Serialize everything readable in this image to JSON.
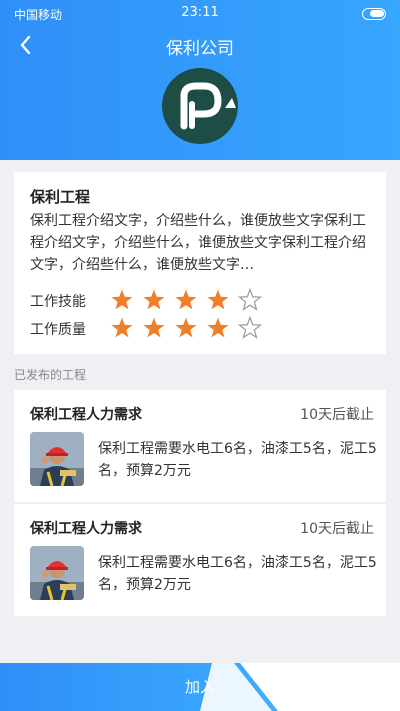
{
  "status_bar": {
    "carrier": "中国移动",
    "time": "23:11"
  },
  "nav": {
    "title": "保利公司",
    "back_icon": "chevron-left-icon"
  },
  "company": {
    "logo_icon": "company-logo",
    "name": "保利工程",
    "description": "保利工程介绍文字，介绍些什么，谁便放些文字保利工程介绍文字，介绍些什么，谁便放些文字保利工程介绍文字，介绍些什么，谁便放些文字…",
    "ratings": [
      {
        "label": "工作技能",
        "value": 4,
        "max": 5
      },
      {
        "label": "工作质量",
        "value": 4,
        "max": 5
      }
    ]
  },
  "published_section_title": "已发布的工程",
  "jobs": [
    {
      "title": "保利工程人力需求",
      "deadline": "10天后截止",
      "description": "保利工程需要水电工6名，油漆工5名，泥工5名，预算2万元",
      "avatar_icon": "worker-photo"
    },
    {
      "title": "保利工程人力需求",
      "deadline": "10天后截止",
      "description": "保利工程需要水电工6名，油漆工5名，泥工5名，预算2万元",
      "avatar_icon": "worker-photo"
    }
  ],
  "join_button": {
    "label": "加入"
  },
  "colors": {
    "primary": "#2f8ff7",
    "star": "#f07f2c",
    "star_empty": "#999999"
  }
}
